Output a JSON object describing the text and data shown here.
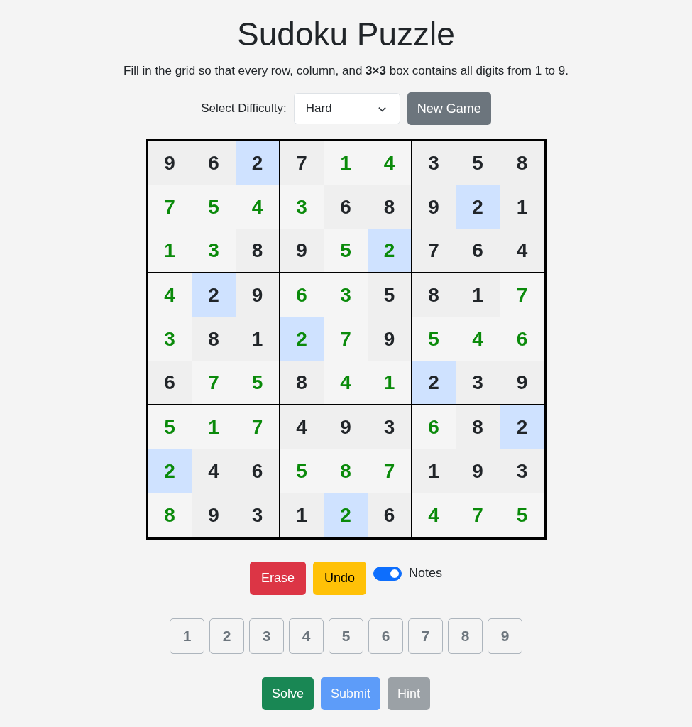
{
  "title": "Sudoku Puzzle",
  "instructions": "Fill in the grid so that every row, column, and **3×3** box contains all digits from 1 to 9.",
  "difficulty": {
    "label": "Select Difficulty:",
    "value": "Hard"
  },
  "new_game_button": "New Game",
  "grid": [
    [
      {
        "value": "9",
        "given": true,
        "highlighted": false
      },
      {
        "value": "6",
        "given": true,
        "highlighted": false
      },
      {
        "value": "2",
        "given": true,
        "highlighted": true
      },
      {
        "value": "7",
        "given": true,
        "highlighted": false
      },
      {
        "value": "1",
        "given": false,
        "highlighted": false
      },
      {
        "value": "4",
        "given": false,
        "highlighted": false
      },
      {
        "value": "3",
        "given": true,
        "highlighted": false
      },
      {
        "value": "5",
        "given": true,
        "highlighted": false
      },
      {
        "value": "8",
        "given": true,
        "highlighted": false
      }
    ],
    [
      {
        "value": "7",
        "given": false,
        "highlighted": false
      },
      {
        "value": "5",
        "given": false,
        "highlighted": false
      },
      {
        "value": "4",
        "given": false,
        "highlighted": false
      },
      {
        "value": "3",
        "given": false,
        "highlighted": false
      },
      {
        "value": "6",
        "given": true,
        "highlighted": false
      },
      {
        "value": "8",
        "given": true,
        "highlighted": false
      },
      {
        "value": "9",
        "given": true,
        "highlighted": false
      },
      {
        "value": "2",
        "given": true,
        "highlighted": true
      },
      {
        "value": "1",
        "given": true,
        "highlighted": false
      }
    ],
    [
      {
        "value": "1",
        "given": false,
        "highlighted": false
      },
      {
        "value": "3",
        "given": false,
        "highlighted": false
      },
      {
        "value": "8",
        "given": true,
        "highlighted": false
      },
      {
        "value": "9",
        "given": true,
        "highlighted": false
      },
      {
        "value": "5",
        "given": false,
        "highlighted": false
      },
      {
        "value": "2",
        "given": false,
        "highlighted": true
      },
      {
        "value": "7",
        "given": true,
        "highlighted": false
      },
      {
        "value": "6",
        "given": true,
        "highlighted": false
      },
      {
        "value": "4",
        "given": true,
        "highlighted": false
      }
    ],
    [
      {
        "value": "4",
        "given": false,
        "highlighted": false
      },
      {
        "value": "2",
        "given": true,
        "highlighted": true
      },
      {
        "value": "9",
        "given": true,
        "highlighted": false
      },
      {
        "value": "6",
        "given": false,
        "highlighted": false
      },
      {
        "value": "3",
        "given": false,
        "highlighted": false
      },
      {
        "value": "5",
        "given": true,
        "highlighted": false
      },
      {
        "value": "8",
        "given": true,
        "highlighted": false
      },
      {
        "value": "1",
        "given": true,
        "highlighted": false
      },
      {
        "value": "7",
        "given": false,
        "highlighted": false
      }
    ],
    [
      {
        "value": "3",
        "given": false,
        "highlighted": false
      },
      {
        "value": "8",
        "given": true,
        "highlighted": false
      },
      {
        "value": "1",
        "given": true,
        "highlighted": false
      },
      {
        "value": "2",
        "given": false,
        "highlighted": true
      },
      {
        "value": "7",
        "given": false,
        "highlighted": false
      },
      {
        "value": "9",
        "given": true,
        "highlighted": false
      },
      {
        "value": "5",
        "given": false,
        "highlighted": false
      },
      {
        "value": "4",
        "given": false,
        "highlighted": false
      },
      {
        "value": "6",
        "given": false,
        "highlighted": false
      }
    ],
    [
      {
        "value": "6",
        "given": true,
        "highlighted": false
      },
      {
        "value": "7",
        "given": false,
        "highlighted": false
      },
      {
        "value": "5",
        "given": false,
        "highlighted": false
      },
      {
        "value": "8",
        "given": true,
        "highlighted": false
      },
      {
        "value": "4",
        "given": false,
        "highlighted": false
      },
      {
        "value": "1",
        "given": false,
        "highlighted": false
      },
      {
        "value": "2",
        "given": true,
        "highlighted": true
      },
      {
        "value": "3",
        "given": true,
        "highlighted": false
      },
      {
        "value": "9",
        "given": true,
        "highlighted": false
      }
    ],
    [
      {
        "value": "5",
        "given": false,
        "highlighted": false
      },
      {
        "value": "1",
        "given": false,
        "highlighted": false
      },
      {
        "value": "7",
        "given": false,
        "highlighted": false
      },
      {
        "value": "4",
        "given": true,
        "highlighted": false
      },
      {
        "value": "9",
        "given": true,
        "highlighted": false
      },
      {
        "value": "3",
        "given": true,
        "highlighted": false
      },
      {
        "value": "6",
        "given": false,
        "highlighted": false
      },
      {
        "value": "8",
        "given": true,
        "highlighted": false
      },
      {
        "value": "2",
        "given": true,
        "highlighted": true
      }
    ],
    [
      {
        "value": "2",
        "given": false,
        "highlighted": true
      },
      {
        "value": "4",
        "given": true,
        "highlighted": false
      },
      {
        "value": "6",
        "given": true,
        "highlighted": false
      },
      {
        "value": "5",
        "given": false,
        "highlighted": false
      },
      {
        "value": "8",
        "given": false,
        "highlighted": false
      },
      {
        "value": "7",
        "given": false,
        "highlighted": false
      },
      {
        "value": "1",
        "given": true,
        "highlighted": false
      },
      {
        "value": "9",
        "given": true,
        "highlighted": false
      },
      {
        "value": "3",
        "given": true,
        "highlighted": false
      }
    ],
    [
      {
        "value": "8",
        "given": false,
        "highlighted": false
      },
      {
        "value": "9",
        "given": true,
        "highlighted": false
      },
      {
        "value": "3",
        "given": true,
        "highlighted": false
      },
      {
        "value": "1",
        "given": true,
        "highlighted": false
      },
      {
        "value": "2",
        "given": false,
        "highlighted": true
      },
      {
        "value": "6",
        "given": true,
        "highlighted": false
      },
      {
        "value": "4",
        "given": false,
        "highlighted": false
      },
      {
        "value": "7",
        "given": false,
        "highlighted": false
      },
      {
        "value": "5",
        "given": false,
        "highlighted": false
      }
    ]
  ],
  "tools": [
    {
      "kind": "erase",
      "label": "Erase"
    },
    {
      "kind": "undo",
      "label": "Undo"
    }
  ],
  "notes_toggle": {
    "label": "Notes",
    "on": true
  },
  "number_pad": [
    "1",
    "2",
    "3",
    "4",
    "5",
    "6",
    "7",
    "8",
    "9"
  ],
  "actions": [
    {
      "kind": "solve",
      "label": "Solve",
      "disabled": false
    },
    {
      "kind": "submit",
      "label": "Submit",
      "disabled": true
    },
    {
      "kind": "hint",
      "label": "Hint",
      "disabled": true
    }
  ]
}
